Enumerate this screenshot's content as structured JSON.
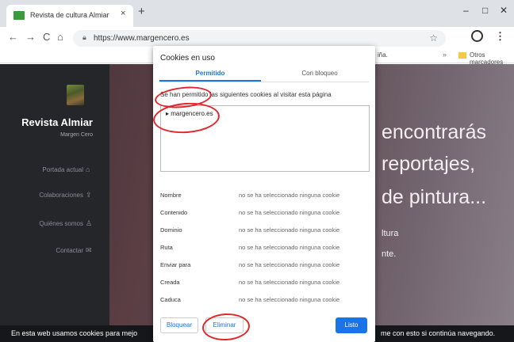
{
  "browser": {
    "tab_title": "Revista de cultura Almiar",
    "tab_close": "×",
    "new_tab": "+",
    "window_controls": {
      "minimize": "–",
      "maximize": "□",
      "close": "✕"
    },
    "nav": {
      "back": "←",
      "forward": "→",
      "reload": "C",
      "home": "⌂"
    },
    "url": "https://www.margencero.es",
    "bookmark_fragment": "iña.",
    "bookmark_separator": "»",
    "bookmark_folder": "Otros marcadores",
    "menu": "⋮"
  },
  "site": {
    "title": "Revista Almiar",
    "subtitle": "Margen Cero",
    "nav": [
      {
        "label": "Portada actual",
        "icon": "⌂"
      },
      {
        "label": "Colaboraciones",
        "icon": "⇪"
      },
      {
        "label": "Quiénes somos",
        "icon": "♙"
      },
      {
        "label": "Contactar",
        "icon": "✉"
      }
    ],
    "hero": [
      "encontrarás",
      "reportajes,",
      "de pintura...",
      "ltura",
      "nte."
    ],
    "cookie_banner_left": "En esta web usamos cookies para mejo",
    "cookie_banner_right": "me con esto si continúa navegando."
  },
  "dialog": {
    "title": "Cookies en uso",
    "tabs": {
      "allowed": "Permitido",
      "blocked": "Con bloqueo"
    },
    "description": "Se han permitido las siguientes cookies al visitar esta página",
    "cookie_item": "▸ margencero.es",
    "fields": [
      {
        "label": "Nombre",
        "value": "no se ha seleccionado ninguna cookie"
      },
      {
        "label": "Contenido",
        "value": "no se ha seleccionado ninguna cookie"
      },
      {
        "label": "Dominio",
        "value": "no se ha seleccionado ninguna cookie"
      },
      {
        "label": "Ruta",
        "value": "no se ha seleccionado ninguna cookie"
      },
      {
        "label": "Enviar para",
        "value": "no se ha seleccionado ninguna cookie"
      },
      {
        "label": "Creada",
        "value": "no se ha seleccionado ninguna cookie"
      },
      {
        "label": "Caduca",
        "value": "no se ha seleccionado ninguna cookie"
      }
    ],
    "buttons": {
      "block": "Bloquear",
      "delete": "Eliminar",
      "done": "Listo"
    }
  },
  "colors": {
    "accent": "#1a73e8",
    "annotation": "#e0282d",
    "sidebar": "#24262a"
  }
}
